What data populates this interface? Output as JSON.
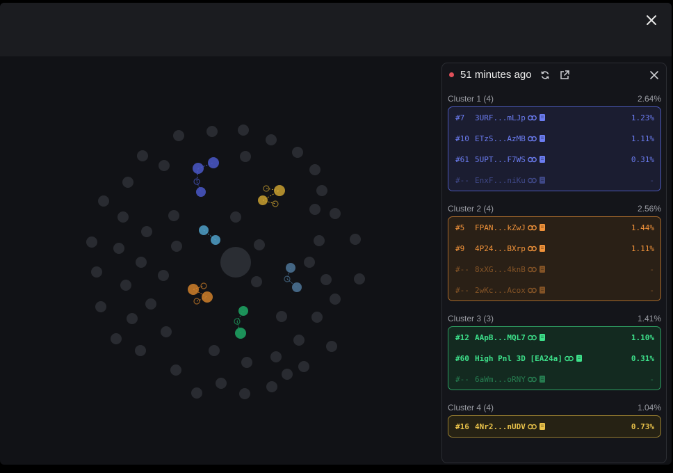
{
  "header": {
    "close_icon": "close-icon"
  },
  "panel": {
    "time_label": "51 minutes ago",
    "live_color": "#e0505a",
    "icons": {
      "refresh": "refresh-icon",
      "external": "external-link-icon",
      "close": "close-icon"
    },
    "clusters": [
      {
        "name": "Cluster 1 (4)",
        "pct": "2.64%",
        "color": "#6b7cf0",
        "bg": "#1b1d31",
        "border": "#4b58b8",
        "rows": [
          {
            "rank": "#7",
            "addr": "3URF...mLJp",
            "pct": "1.23%",
            "dim": false
          },
          {
            "rank": "#10",
            "addr": "ETzS...AzMB",
            "pct": "1.11%",
            "dim": false
          },
          {
            "rank": "#61",
            "addr": "5UPT...F7WS",
            "pct": "0.31%",
            "dim": false
          },
          {
            "rank": "#--",
            "addr": "EnxF...niKu",
            "pct": "-",
            "dim": true
          }
        ]
      },
      {
        "name": "Cluster 2 (4)",
        "pct": "2.56%",
        "color": "#f0923a",
        "bg": "#2a2016",
        "border": "#a86a2c",
        "rows": [
          {
            "rank": "#5",
            "addr": "FPAN...kZwJ",
            "pct": "1.44%",
            "dim": false
          },
          {
            "rank": "#9",
            "addr": "4P24...BXrp",
            "pct": "1.11%",
            "dim": false
          },
          {
            "rank": "#--",
            "addr": "8xXG...4knB",
            "pct": "-",
            "dim": true
          },
          {
            "rank": "#--",
            "addr": "2wKc...Acox",
            "pct": "-",
            "dim": true
          }
        ]
      },
      {
        "name": "Cluster 3 (3)",
        "pct": "1.41%",
        "color": "#3de08a",
        "bg": "#132a20",
        "border": "#2e9e62",
        "rows": [
          {
            "rank": "#12",
            "addr": "AApB...MQL7",
            "pct": "1.10%",
            "dim": false,
            "bold": true
          },
          {
            "rank": "#60",
            "addr": "High Pnl 3D [EA24a]",
            "pct": "0.31%",
            "dim": false,
            "bold": true
          },
          {
            "rank": "#--",
            "addr": "6aWm...oRNY",
            "pct": "-",
            "dim": true
          }
        ]
      },
      {
        "name": "Cluster 4 (4)",
        "pct": "1.04%",
        "color": "#e8c14a",
        "bg": "#262214",
        "border": "#9a8030",
        "rows": [
          {
            "rank": "#16",
            "addr": "4Nr2...nUDV",
            "pct": "0.73%",
            "dim": false,
            "bold": true
          }
        ]
      }
    ]
  },
  "graph": {
    "center_color": "#2a2d33",
    "node_color": "#2b2d33",
    "clusters": [
      {
        "color": "#4a58c8"
      },
      {
        "color": "#c9a030"
      },
      {
        "color": "#4fa0c8"
      },
      {
        "color": "#d0802a"
      },
      {
        "color": "#1ea060"
      },
      {
        "color": "#4a7090"
      }
    ]
  }
}
